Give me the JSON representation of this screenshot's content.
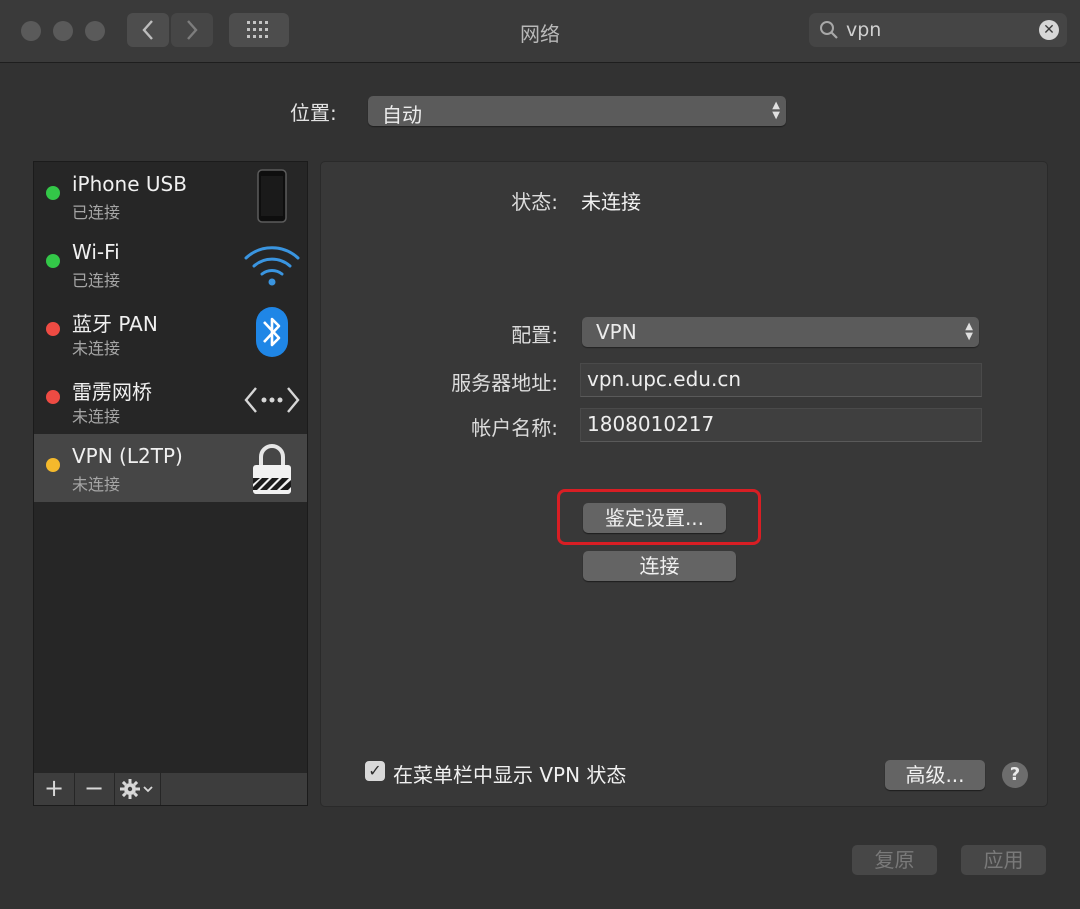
{
  "window": {
    "title": "网络",
    "search_value": "vpn"
  },
  "location": {
    "label": "位置:",
    "value": "自动"
  },
  "services": [
    {
      "name": "iPhone USB",
      "status": "已连接",
      "color": "#33c748",
      "icon": "iphone-icon"
    },
    {
      "name": "Wi-Fi",
      "status": "已连接",
      "color": "#33c748",
      "icon": "wifi-icon"
    },
    {
      "name": "蓝牙 PAN",
      "status": "未连接",
      "color": "#ee4b43",
      "icon": "bluetooth-icon"
    },
    {
      "name": "雷雳网桥",
      "status": "未连接",
      "color": "#ee4b43",
      "icon": "thunderbolt-bridge-icon"
    },
    {
      "name": "VPN (L2TP)",
      "status": "未连接",
      "color": "#f4b92c",
      "icon": "lock-icon",
      "selected": true
    }
  ],
  "sidebar_toolbar": {
    "add": "+",
    "remove": "−"
  },
  "detail": {
    "status_label": "状态:",
    "status_value": "未连接",
    "config_label": "配置:",
    "config_value": "VPN",
    "server_label": "服务器地址:",
    "server_value": "vpn.upc.edu.cn",
    "account_label": "帐户名称:",
    "account_value": "1808010217",
    "auth_button": "鉴定设置...",
    "connect_button": "连接",
    "show_vpn_checkbox_label": "在菜单栏中显示 VPN 状态",
    "show_vpn_checked": true,
    "advanced_button": "高级...",
    "help": "?"
  },
  "footer": {
    "revert": "复原",
    "apply": "应用"
  },
  "colors": {
    "highlight": "#d81e24"
  }
}
